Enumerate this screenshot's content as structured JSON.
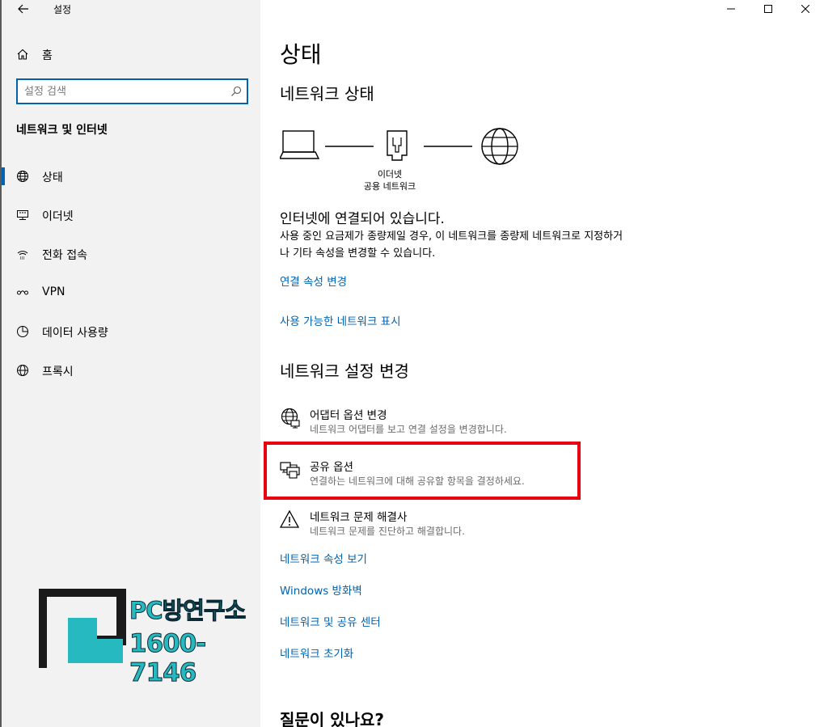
{
  "window": {
    "title": "설정"
  },
  "sidebar": {
    "home_label": "홈",
    "search_placeholder": "설정 검색",
    "section_title": "네트워크 및 인터넷",
    "items": [
      {
        "label": "상태",
        "icon": "globe-status-icon",
        "selected": true
      },
      {
        "label": "이더넷",
        "icon": "ethernet-icon",
        "selected": false
      },
      {
        "label": "전화 접속",
        "icon": "dial-up-icon",
        "selected": false
      },
      {
        "label": "VPN",
        "icon": "vpn-icon",
        "selected": false
      },
      {
        "label": "데이터 사용량",
        "icon": "data-usage-icon",
        "selected": false
      },
      {
        "label": "프록시",
        "icon": "globe-icon",
        "selected": false
      }
    ],
    "promo": {
      "brand": "PC방연구소",
      "phone": "1600-7146"
    }
  },
  "main": {
    "title": "상태",
    "network_status_heading": "네트워크 상태",
    "diagram": {
      "caption_line1": "이더넷",
      "caption_line2": "공용 네트워크"
    },
    "status_heading": "인터넷에 연결되어 있습니다.",
    "status_desc": "사용 중인 요금제가 종량제일 경우, 이 네트워크를 종량제 네트워크로 지정하거나 기타 속성을 변경할 수 있습니다.",
    "link_connection_props": "연결 속성 변경",
    "link_show_networks": "사용 가능한 네트워크 표시",
    "change_settings_heading": "네트워크 설정 변경",
    "options": [
      {
        "title": "어댑터 옵션 변경",
        "desc": "네트워크 어댑터를 보고 연결 설정을 변경합니다."
      },
      {
        "title": "공유 옵션",
        "desc": "연결하는 네트워크에 대해 공유할 항목을 결정하세요."
      },
      {
        "title": "네트워크 문제 해결사",
        "desc": "네트워크 문제를 진단하고 해결합니다."
      }
    ],
    "links": [
      "네트워크 속성 보기",
      "Windows 방화벽",
      "네트워크 및 공유 센터",
      "네트워크 초기화"
    ],
    "question_heading": "질문이 있나요?"
  },
  "colors": {
    "accent": "#0063b1",
    "highlight": "#e60012",
    "sidebar_bg": "#f2f2f2",
    "brand": "#27b9c0"
  }
}
